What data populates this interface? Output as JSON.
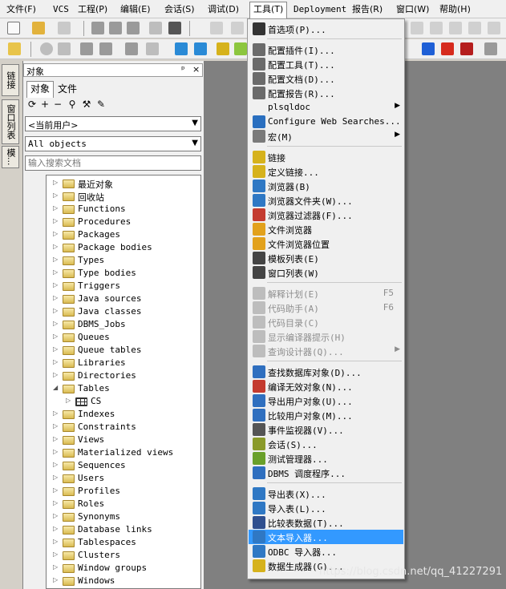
{
  "menubar": [
    "文件(F)",
    "VCS",
    "工程(P)",
    "编辑(E)",
    "会话(S)",
    "调试(D)",
    "工具(T)",
    "Deployment",
    "报告(R)",
    "窗口(W)",
    "帮助(H)"
  ],
  "side_tabs": [
    "链接",
    "窗口列表",
    "模..."
  ],
  "object_panel": {
    "title": "对象",
    "pin": "ᵖ",
    "close": "×",
    "tabs": [
      "对象",
      "文件"
    ],
    "owner_combo": "<当前用户>",
    "type_combo": "All objects",
    "search_placeholder": "输入搜索文档",
    "tree": [
      {
        "label": "最近对象",
        "type": "folder",
        "expanded": false
      },
      {
        "label": "回收站",
        "type": "folder",
        "expanded": false
      },
      {
        "label": "Functions",
        "type": "folder",
        "expanded": false
      },
      {
        "label": "Procedures",
        "type": "folder",
        "expanded": false
      },
      {
        "label": "Packages",
        "type": "folder",
        "expanded": false
      },
      {
        "label": "Package bodies",
        "type": "folder",
        "expanded": false
      },
      {
        "label": "Types",
        "type": "folder",
        "expanded": false
      },
      {
        "label": "Type bodies",
        "type": "folder",
        "expanded": false
      },
      {
        "label": "Triggers",
        "type": "folder",
        "expanded": false
      },
      {
        "label": "Java sources",
        "type": "folder",
        "expanded": false
      },
      {
        "label": "Java classes",
        "type": "folder",
        "expanded": false
      },
      {
        "label": "DBMS_Jobs",
        "type": "folder",
        "expanded": false
      },
      {
        "label": "Queues",
        "type": "folder",
        "expanded": false
      },
      {
        "label": "Queue tables",
        "type": "folder",
        "expanded": false
      },
      {
        "label": "Libraries",
        "type": "folder",
        "expanded": false
      },
      {
        "label": "Directories",
        "type": "folder",
        "expanded": false
      },
      {
        "label": "Tables",
        "type": "folder",
        "expanded": true
      },
      {
        "label": "CS",
        "type": "table",
        "child": true
      },
      {
        "label": "Indexes",
        "type": "folder",
        "expanded": false
      },
      {
        "label": "Constraints",
        "type": "folder",
        "expanded": false
      },
      {
        "label": "Views",
        "type": "folder",
        "expanded": false
      },
      {
        "label": "Materialized views",
        "type": "folder",
        "expanded": false
      },
      {
        "label": "Sequences",
        "type": "folder",
        "expanded": false
      },
      {
        "label": "Users",
        "type": "folder",
        "expanded": false
      },
      {
        "label": "Profiles",
        "type": "folder",
        "expanded": false
      },
      {
        "label": "Roles",
        "type": "folder",
        "expanded": false
      },
      {
        "label": "Synonyms",
        "type": "folder",
        "expanded": false
      },
      {
        "label": "Database links",
        "type": "folder",
        "expanded": false
      },
      {
        "label": "Tablespaces",
        "type": "folder",
        "expanded": false
      },
      {
        "label": "Clusters",
        "type": "folder",
        "expanded": false
      },
      {
        "label": "Window groups",
        "type": "folder",
        "expanded": false
      },
      {
        "label": "Windows",
        "type": "folder",
        "expanded": false
      }
    ]
  },
  "tools_menu": {
    "groups": [
      [
        {
          "label": "首选项(P)...",
          "icon": "wrench-icon",
          "color": "#333333"
        }
      ],
      [
        {
          "label": "配置插件(I)...",
          "icon": "plugin-config-icon",
          "color": "#6b6b6b"
        },
        {
          "label": "配置工具(T)...",
          "icon": "tools-config-icon",
          "color": "#6b6b6b"
        },
        {
          "label": "配置文档(D)...",
          "icon": "doc-config-icon",
          "color": "#6b6b6b"
        },
        {
          "label": "配置报告(R)...",
          "icon": "report-config-icon",
          "color": "#6b6b6b"
        },
        {
          "label": "plsqldoc",
          "icon": "",
          "submenu": true
        },
        {
          "label": "Configure Web Searches...",
          "icon": "web-search-icon",
          "color": "#2a6fbf"
        },
        {
          "label": "宏(M)",
          "icon": "macro-icon",
          "color": "#7a7a7a",
          "submenu": true
        }
      ],
      [
        {
          "label": "链接",
          "icon": "db-link-icon",
          "color": "#d6b21c"
        },
        {
          "label": "定义链接...",
          "icon": "define-link-icon",
          "color": "#d6b21c"
        },
        {
          "label": "浏览器(B)",
          "icon": "browser-icon",
          "color": "#2f78c4"
        },
        {
          "label": "浏览器文件夹(W)...",
          "icon": "browser-folder-icon",
          "color": "#2f78c4"
        },
        {
          "label": "浏览器过滤器(F)...",
          "icon": "browser-filter-icon",
          "color": "#c43b2f"
        },
        {
          "label": "文件浏览器",
          "icon": "file-browser-icon",
          "color": "#e2a11c"
        },
        {
          "label": "文件浏览器位置",
          "icon": "file-browser-location-icon",
          "color": "#e2a11c"
        },
        {
          "label": "模板列表(E)",
          "icon": "template-list-icon",
          "color": "#444444"
        },
        {
          "label": "窗口列表(W)",
          "icon": "window-list-icon",
          "color": "#444444"
        }
      ],
      [
        {
          "label": "解释计划(E)",
          "icon": "explain-plan-icon",
          "color": "#bdbdbd",
          "shortcut": "F5",
          "disabled": true
        },
        {
          "label": "代码助手(A)",
          "icon": "code-assistant-icon",
          "color": "#bdbdbd",
          "shortcut": "F6",
          "disabled": true
        },
        {
          "label": "代码目录(C)",
          "icon": "code-contents-icon",
          "color": "#bdbdbd",
          "disabled": true
        },
        {
          "label": "显示编译器提示(H)",
          "icon": "compiler-hints-icon",
          "color": "#bdbdbd",
          "disabled": true
        },
        {
          "label": "查询设计器(Q)...",
          "icon": "query-builder-icon",
          "color": "#bdbdbd",
          "disabled": true,
          "submenu": true
        }
      ],
      [
        {
          "label": "查找数据库对象(D)...",
          "icon": "find-objects-icon",
          "color": "#2f6fbf"
        },
        {
          "label": "编译无效对象(N)...",
          "icon": "compile-invalid-icon",
          "color": "#c43b2f"
        },
        {
          "label": "导出用户对象(U)...",
          "icon": "export-user-objects-icon",
          "color": "#2f6fbf"
        },
        {
          "label": "比较用户对象(M)...",
          "icon": "compare-user-objects-icon",
          "color": "#2f6fbf"
        },
        {
          "label": "事件监视器(V)...",
          "icon": "event-monitor-icon",
          "color": "#555555"
        },
        {
          "label": "会话(S)...",
          "icon": "sessions-icon",
          "color": "#8a9a2a"
        },
        {
          "label": "测试管理器...",
          "icon": "test-manager-icon",
          "color": "#6aa02a"
        },
        {
          "label": "DBMS 调度程序...",
          "icon": "dbms-scheduler-icon",
          "color": "#2f6fbf"
        }
      ],
      [
        {
          "label": "导出表(X)...",
          "icon": "export-tables-icon",
          "color": "#2f78c4"
        },
        {
          "label": "导入表(L)...",
          "icon": "import-tables-icon",
          "color": "#2f78c4"
        },
        {
          "label": "比较表数据(T)...",
          "icon": "compare-table-data-icon",
          "color": "#2f4f8f"
        },
        {
          "label": "文本导入器...",
          "icon": "text-importer-icon",
          "color": "#2f78c4",
          "highlight": true
        },
        {
          "label": "ODBC 导入器...",
          "icon": "odbc-importer-icon",
          "color": "#2f78c4"
        },
        {
          "label": "数据生成器(G)...",
          "icon": "data-generator-icon",
          "color": "#d6b21c"
        }
      ]
    ]
  },
  "watermark": "https://blog.csdn.net/qq_41227291"
}
